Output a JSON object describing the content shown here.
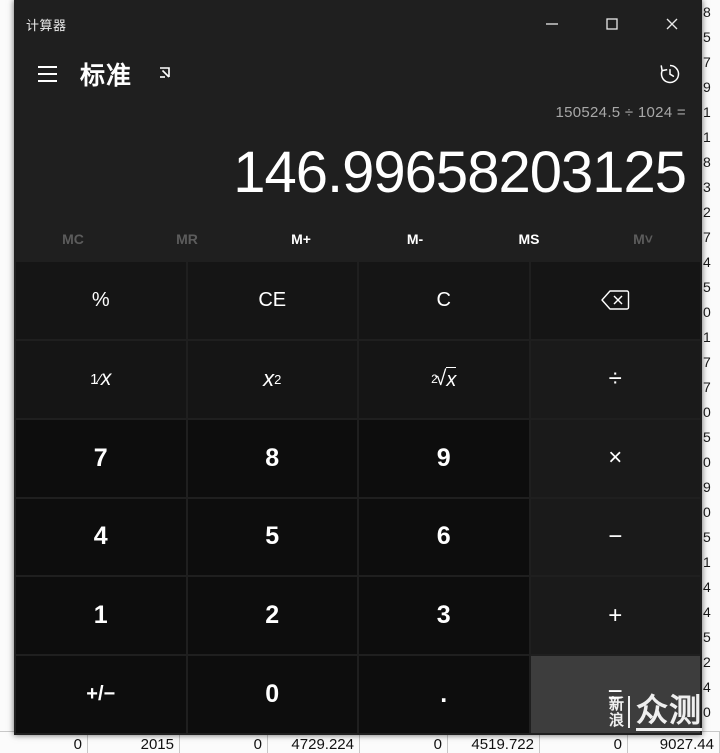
{
  "window": {
    "title": "计算器",
    "controls": {
      "minimize": "minimize",
      "maximize": "maximize",
      "close": "close"
    }
  },
  "nav": {
    "menu_label": "menu",
    "mode_title": "标准",
    "keep_on_top_label": "keep-on-top",
    "history_label": "history"
  },
  "display": {
    "expression": "150524.5 ÷ 1024 =",
    "result": "146.99658203125"
  },
  "memory": {
    "buttons": [
      {
        "label": "MC",
        "enabled": false
      },
      {
        "label": "MR",
        "enabled": false
      },
      {
        "label": "M+",
        "enabled": true
      },
      {
        "label": "M-",
        "enabled": true
      },
      {
        "label": "MS",
        "enabled": true
      },
      {
        "label": "M˅",
        "enabled": false
      }
    ]
  },
  "keypad": {
    "rows": [
      [
        {
          "name": "percent",
          "label": "%",
          "kind": "fn"
        },
        {
          "name": "clear-entry",
          "label": "CE",
          "kind": "fn"
        },
        {
          "name": "clear",
          "label": "C",
          "kind": "fn"
        },
        {
          "name": "backspace",
          "label": "⌫",
          "kind": "fn"
        }
      ],
      [
        {
          "name": "reciprocal",
          "label": "1⁄x",
          "kind": "fn"
        },
        {
          "name": "square",
          "label": "x²",
          "kind": "fn"
        },
        {
          "name": "square-root",
          "label": "²√x",
          "kind": "fn"
        },
        {
          "name": "divide",
          "label": "÷",
          "kind": "op"
        }
      ],
      [
        {
          "name": "seven",
          "label": "7",
          "kind": "num"
        },
        {
          "name": "eight",
          "label": "8",
          "kind": "num"
        },
        {
          "name": "nine",
          "label": "9",
          "kind": "num"
        },
        {
          "name": "multiply",
          "label": "×",
          "kind": "op"
        }
      ],
      [
        {
          "name": "four",
          "label": "4",
          "kind": "num"
        },
        {
          "name": "five",
          "label": "5",
          "kind": "num"
        },
        {
          "name": "six",
          "label": "6",
          "kind": "num"
        },
        {
          "name": "subtract",
          "label": "−",
          "kind": "op"
        }
      ],
      [
        {
          "name": "one",
          "label": "1",
          "kind": "num"
        },
        {
          "name": "two",
          "label": "2",
          "kind": "num"
        },
        {
          "name": "three",
          "label": "3",
          "kind": "num"
        },
        {
          "name": "add",
          "label": "+",
          "kind": "op"
        }
      ],
      [
        {
          "name": "negate",
          "label": "⁺∕₋",
          "kind": "num"
        },
        {
          "name": "zero",
          "label": "0",
          "kind": "num"
        },
        {
          "name": "decimal",
          "label": ".",
          "kind": "num"
        },
        {
          "name": "equals",
          "label": "=",
          "kind": "equals"
        }
      ]
    ]
  },
  "backdrop": {
    "right_column_digits": [
      "8",
      "5",
      "7",
      "9",
      "1",
      "1",
      "8",
      "3",
      "2",
      "7",
      "4",
      "5",
      "0",
      "1",
      "7",
      "7",
      "0",
      "5",
      "0",
      "9",
      "0",
      "5",
      "1",
      "4",
      "4",
      "5",
      "2",
      "4",
      "0"
    ],
    "bottom_row_cells": [
      "0",
      "2015",
      "0",
      "4729.224",
      "0",
      "4519.722",
      "0",
      "9027.44"
    ]
  },
  "watermark": {
    "small": "新浪",
    "big": "众测"
  },
  "colors": {
    "window_bg": "#1f1f1f",
    "number_key": "#0d0d0d",
    "function_key": "#151515",
    "operator_key": "#1a1a1a",
    "equals_key": "#3d3d3d",
    "text": "#ffffff",
    "muted_text": "#a8a8a8",
    "disabled_text": "#5c5c5c"
  }
}
